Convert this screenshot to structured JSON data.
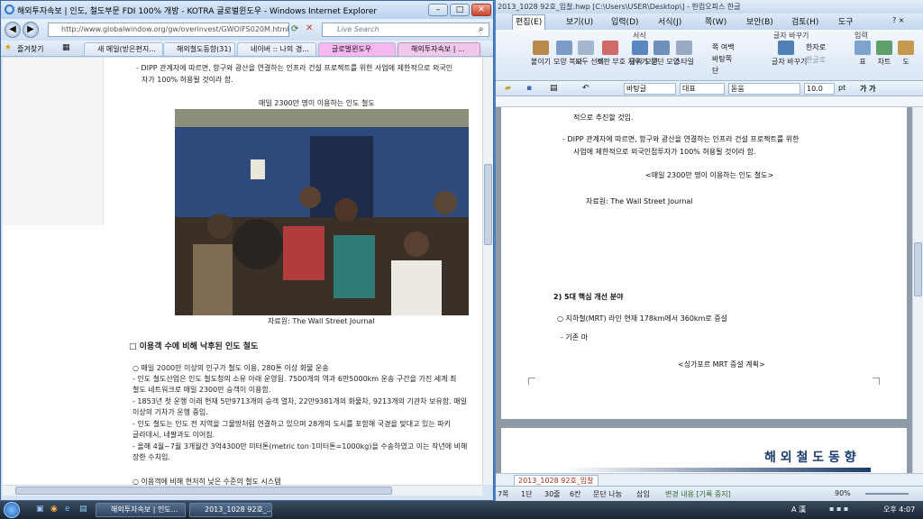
{
  "ie": {
    "title": "해외투자속보 | 인도, 철도부문 FDI 100% 개방 - KOTRA 글로벌윈도우 - Windows Internet Explorer",
    "url": "http://www.globalwindow.org/gw/overinvest/GWOIFS020M.html?",
    "search_placeholder": "Live Search",
    "favorites_label": "즐겨찾기",
    "tabs": [
      "새 메일(받은편지...",
      "해외철도동향(31) ...",
      "네이버 :: 나의 경...",
      "글로벌윈도우",
      "해외투자속보 | ..."
    ],
    "content": {
      "top_line1": "- DIPP 관계자에 따르면, 항구와 광산을 연결하는 인프라 건설 프로젝트를 위한 사업에 제한적으로 외국인",
      "top_line2": "자가 100% 허용될 것이라 함.",
      "photo_caption": "매일 2300만 명이 이용하는 인도 철도",
      "photo_source": "자료원: The Wall Street Journal",
      "section_heading": "□ 이용객 수에 비해 낙후된 인도 철도",
      "bullets": [
        "○ 매일 2000만 이상의 인구가 철도 이용, 280톤 이상 화물 운송",
        "- 인도 철도산업은 인도 철도청의 소유 아래 운영됨. 7500개의 역과 6만5000km 운송 구간을 가진 세계 최",
        "  철도 네트워크로 매일 2300만 승객이 이용함.",
        "- 1853년 첫 운행 이래 현재 5만9713개의 승객 열차, 22만9381개의 화물차, 9213개의 기관차 보유함. 매일",
        "  이상의 기차가 운행 중임.",
        "- 인도 철도는 인도 전 지역을 그물망처럼 연결하고 있으며 28개의 도시를 포함해 국경을 맞대고 있는 파키",
        "  글라데시, 네팔과도 이어짐.",
        "- 올해 4월~7월 3개월간 3억4300만 미터톤(metric ton·1미터톤=1000kg)을 수송하였고 이는 작년에 비해",
        "  장한 수치임.",
        "○ 이용객에 비해 현저히 낮은 수준의 철도 시스템"
      ]
    }
  },
  "hwp": {
    "title": "2013_1028 92호_입찰.hwp [C:\\Users\\USER\\Desktop\\] - 한컴오피스 한글",
    "menus": [
      "편집(E)",
      "보기(U)",
      "입력(D)",
      "서식(J)",
      "쪽(W)",
      "보안(B)",
      "검토(H)",
      "도구"
    ],
    "ribbon": {
      "group_labels": [
        "서식",
        "글자 바꾸기",
        "입력"
      ],
      "buttons": [
        "붙이기",
        "모양 복사",
        "모두 선택",
        "조판 부호 지우기",
        "글자 모양",
        "문단 모양",
        "스타일",
        "쪽 여백",
        "바탕쪽",
        "단",
        "글자 바꾸기",
        "한자로",
        "한글로",
        "표",
        "차트",
        "도"
      ]
    },
    "format_bar": {
      "style": "바탕글",
      "lang": "대표",
      "font": "돋움",
      "size": "10.0",
      "unit": "pt",
      "bold_italic": "가 가"
    },
    "doc": {
      "line_top": "적으로 추진할 것임.",
      "line_dipp1": "- DIPP 관계자에 따르면, 항구와 광산을 연결하는 인프라 건설 프로젝트를 위한",
      "line_dipp2": "사업에 제한적으로 외국인접투자가 100% 허용될 것이라 함.",
      "caption": "<매일 2300만 명이 이용하는 인도 철도>",
      "source": "자료원: The Wall Street Journal",
      "section": "2) 5대 핵심 개선 분야",
      "mrt_line": "○ 지하철(MRT) 라인 현재 178km에서 360km로 증설",
      "existing": "- 기존 마",
      "sg_caption": "<싱가포르 MRT 증설 계획>",
      "footer_title": "해 외 철 도 동 향"
    },
    "doc_tab": "2013_1028 92호_입찰",
    "status": [
      "7쪽",
      "1단",
      "30줄",
      "6칸",
      "문단 나눔",
      "삽입",
      "변경 내용 [기록 중지]"
    ],
    "zoom": "90%"
  },
  "taskbar": {
    "buttons": [
      "해외투자속보 | 인도...",
      "2013_1028 92호_..."
    ],
    "tray": "A 漢",
    "clock": "오후 4:07"
  }
}
